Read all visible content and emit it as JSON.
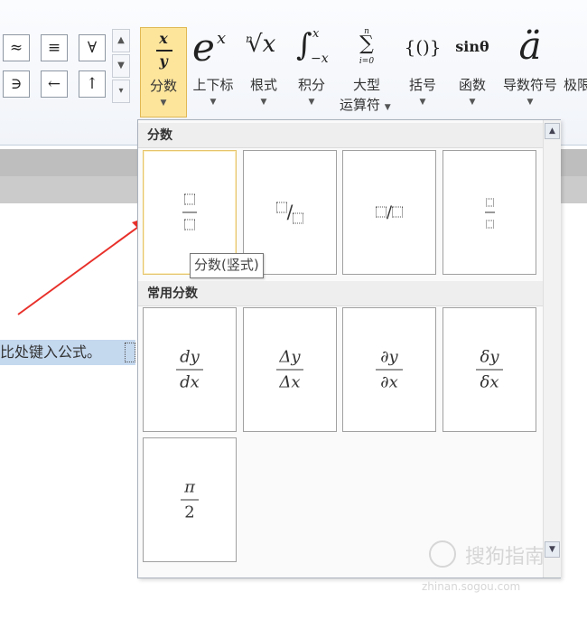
{
  "ribbon": {
    "symbols": [
      "≈",
      "≡",
      "∀",
      "∋",
      "←",
      "↑"
    ],
    "buttons": [
      {
        "key": "fraction",
        "label": "分数"
      },
      {
        "key": "script",
        "label": "上下标"
      },
      {
        "key": "radical",
        "label": "根式"
      },
      {
        "key": "integral",
        "label": "积分"
      },
      {
        "key": "large_operator",
        "label_line1": "大型",
        "label_line2": "运算符"
      },
      {
        "key": "bracket",
        "label": "括号"
      },
      {
        "key": "function",
        "label": "函数"
      },
      {
        "key": "accent",
        "label": "导数符号"
      },
      {
        "key": "limit",
        "label": "极限"
      }
    ],
    "glyphs": {
      "fraction_num": "x",
      "fraction_den": "y",
      "script": "e",
      "script_sup": "x",
      "radical_index": "n",
      "radical_base": "√x",
      "integral": "∫",
      "integral_upper": "x",
      "integral_lower": "−x",
      "sum_upper": "n",
      "sum": "∑",
      "sum_lower": "i=0",
      "bracket": "{()}",
      "function": "sinθ",
      "accent": "ä"
    }
  },
  "document": {
    "text": "比处键入公式。"
  },
  "panel": {
    "section1_title": "分数",
    "section2_title": "常用分数",
    "tooltip": "分数(竖式)",
    "common": [
      {
        "num": "dy",
        "den": "dx"
      },
      {
        "num": "Δy",
        "den": "Δx"
      },
      {
        "num": "∂y",
        "den": "∂x"
      },
      {
        "num": "δy",
        "den": "δx"
      },
      {
        "num": "π",
        "den": "2"
      }
    ]
  },
  "watermark": {
    "text": "搜狗指南",
    "url": "zhinan.sogou.com"
  },
  "colors": {
    "accent": "#fde59c",
    "selection": "#c4d8ee",
    "arrow": "#e8302a"
  }
}
